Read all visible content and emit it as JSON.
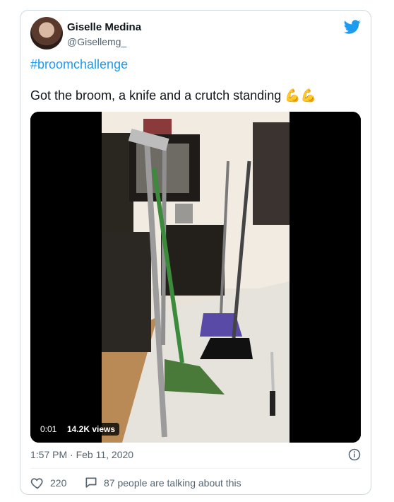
{
  "author": {
    "name": "Giselle Medina",
    "handle": "@Gisellemg_",
    "avatar": "profile-photo"
  },
  "tweet": {
    "hashtag": "#broomchallenge",
    "text": "Got the broom, a knife and a crutch standing",
    "emoji": "💪💪",
    "timestamp": "1:57 PM · Feb 11, 2020"
  },
  "video": {
    "time": "0:01",
    "views": "14.2K views"
  },
  "actions": {
    "likes": "220",
    "reply_label": "87 people are talking about this"
  },
  "colors": {
    "brand": "#1d9bf0",
    "text": "#0f1419",
    "muted": "#536471",
    "border": "#cfd9de"
  },
  "icons": {
    "bird": "twitter-bird-icon",
    "info": "info-icon",
    "like": "heart-icon",
    "reply": "reply-bubble-icon"
  }
}
